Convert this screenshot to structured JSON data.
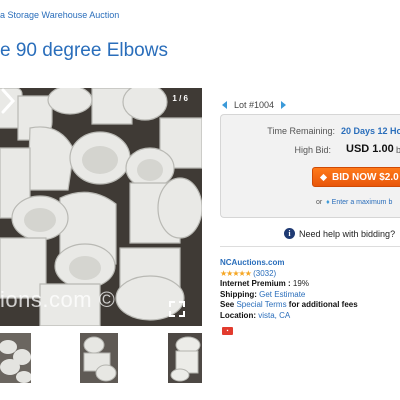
{
  "breadcrumb": "a Storage Warehouse Auction",
  "title": "e 90 degree Elbows",
  "gallery": {
    "counter": "1 / 6",
    "watermark": "ions.com ©"
  },
  "lot": {
    "label": "Lot #1004"
  },
  "bidding": {
    "time_label": "Time Remaining:",
    "time_value": "20 Days 12 Ho",
    "high_bid_label": "High Bid:",
    "high_bid_value": "USD 1.00",
    "high_bid_suffix": "b",
    "bid_button": "BID NOW $2.0",
    "max_bid_prefix": "or",
    "max_bid_link": "Enter a maximum b",
    "help": "Need help with bidding?"
  },
  "seller": {
    "name": "NCAuctions.com",
    "stars": "★★★★★",
    "rating_count": "(3032)",
    "premium_label": "Internet Premium :",
    "premium_value": "19%",
    "shipping_label": "Shipping:",
    "shipping_link": "Get Estimate",
    "terms_prefix": "See",
    "terms_link": "Special Terms",
    "terms_suffix": "for additional fees",
    "location_label": "Location:",
    "location_value": "vista, CA"
  },
  "colors": {
    "link": "#2a6ebb",
    "bid_button": "#f26a12",
    "stars": "#f5a623"
  }
}
